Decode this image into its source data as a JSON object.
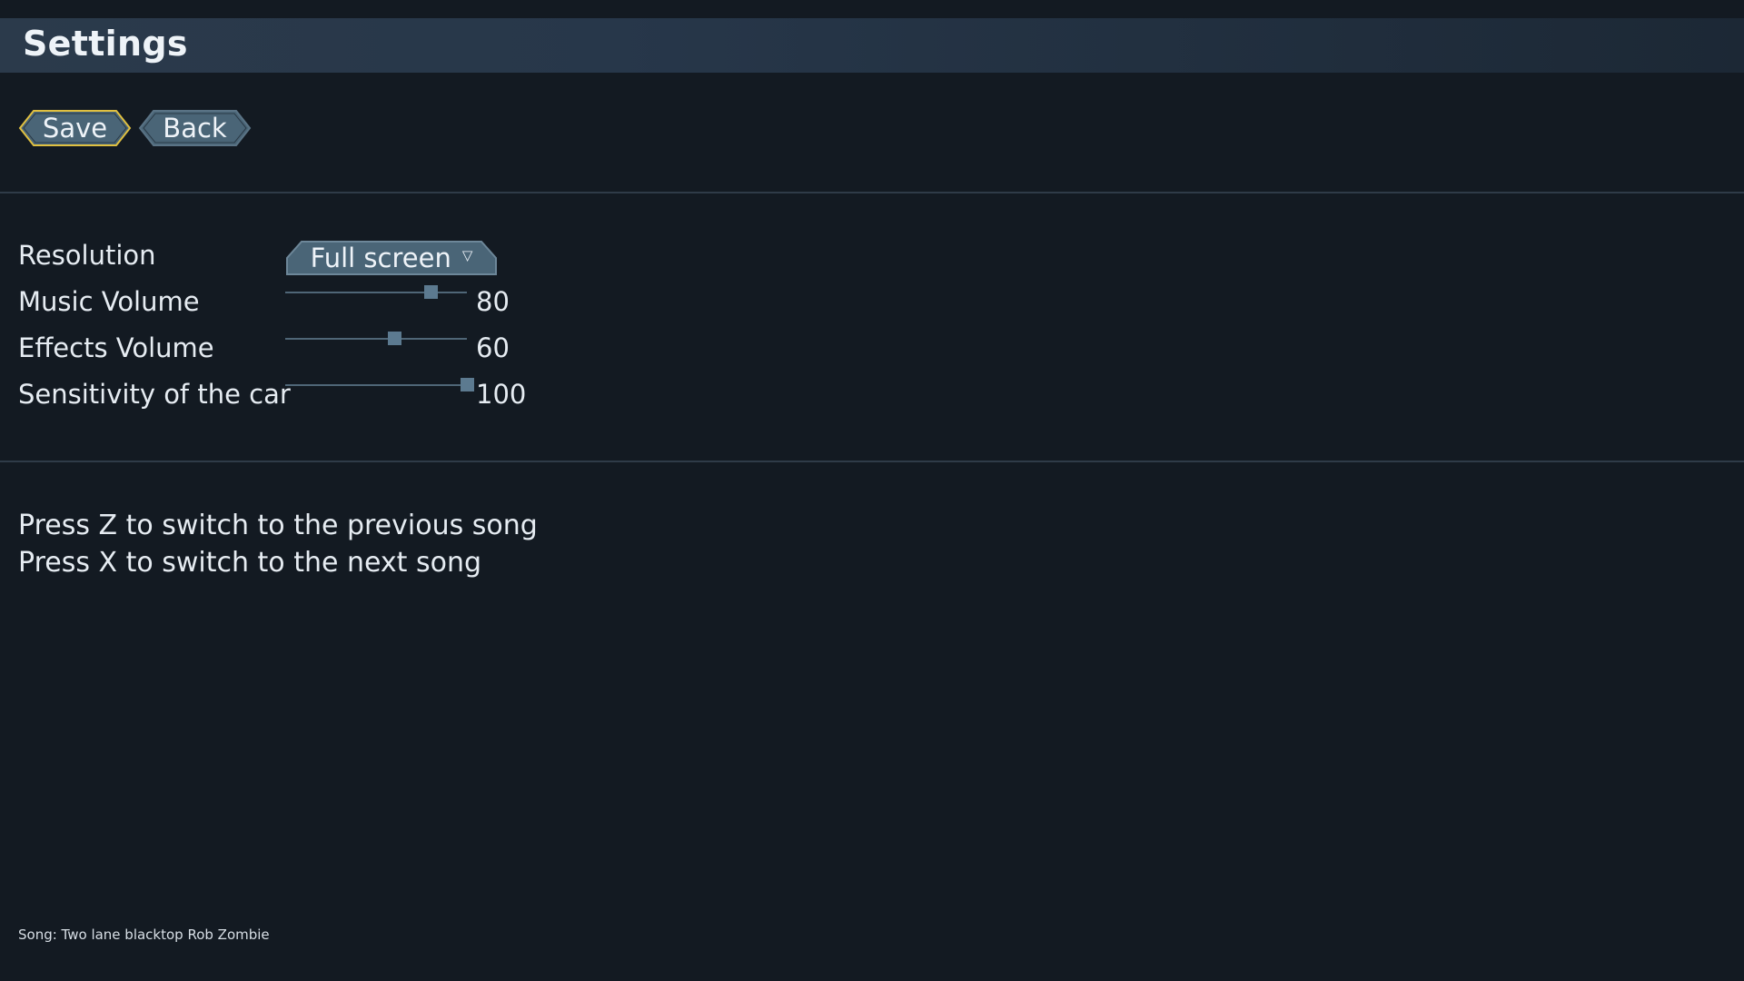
{
  "header": {
    "title": "Settings"
  },
  "buttons": {
    "save_label": "Save",
    "back_label": "Back"
  },
  "colors": {
    "background": "#131a22",
    "header": "#27374a",
    "button_fill": "#4a6577",
    "selected_border": "#e0c040",
    "divider": "#2f3b48"
  },
  "settings": {
    "resolution": {
      "label": "Resolution",
      "value": "Full screen",
      "arrow_icon": "triangle-down-icon"
    },
    "music_volume": {
      "label": "Music Volume",
      "value": 80,
      "value_text": "80"
    },
    "effects_volume": {
      "label": "Effects Volume",
      "value": 60,
      "value_text": "60"
    },
    "sensitivity": {
      "label": "Sensitivity of the car",
      "value": 100,
      "value_text": "100"
    }
  },
  "hints": {
    "previous": "Press Z to switch to the previous song",
    "next": "Press X to switch to the next song"
  },
  "now_playing": "Song: Two lane blacktop Rob Zombie"
}
